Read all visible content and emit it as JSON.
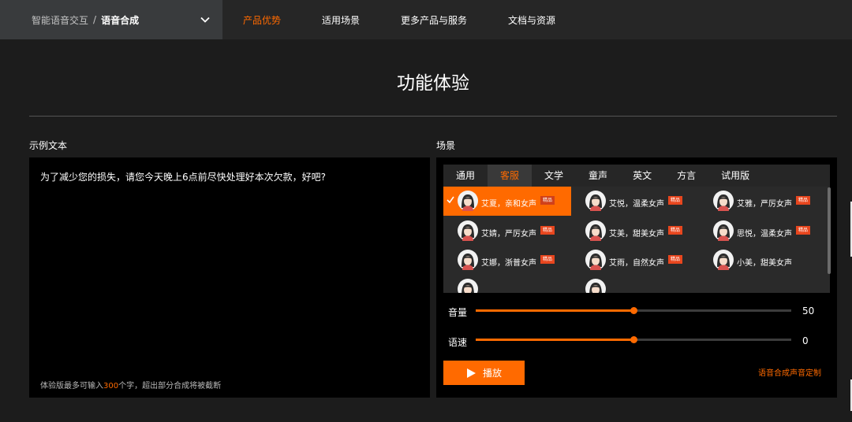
{
  "header": {
    "breadcrumb_parent": "智能语音交互",
    "breadcrumb_sep": "/",
    "breadcrumb_current": "语音合成",
    "nav": [
      {
        "label": "产品优势",
        "active": true
      },
      {
        "label": "适用场景",
        "active": false
      },
      {
        "label": "更多产品与服务",
        "active": false
      },
      {
        "label": "文档与资源",
        "active": false
      }
    ]
  },
  "page_title": "功能体验",
  "text_section": {
    "label": "示例文本",
    "sample_text": "为了减少您的损失，请您今天晚上6点前尽快处理好本次欠款，好吧?",
    "note_prefix": "体验版最多可输入",
    "note_count": "300",
    "note_suffix": "个字，超出部分合成将被截断"
  },
  "scene_section": {
    "label": "场景",
    "tabs": [
      "通用",
      "客服",
      "文学",
      "童声",
      "英文",
      "方言",
      "试用版"
    ],
    "active_tab": "客服",
    "badge_label": "精品",
    "voices": [
      {
        "name": "艾夏，亲和女声",
        "premium": true,
        "selected": true
      },
      {
        "name": "艾悦，温柔女声",
        "premium": true,
        "selected": false
      },
      {
        "name": "艾雅，严厉女声",
        "premium": true,
        "selected": false
      },
      {
        "name": "艾婧，严厉女声",
        "premium": true,
        "selected": false
      },
      {
        "name": "艾美，甜美女声",
        "premium": true,
        "selected": false
      },
      {
        "name": "思悦，温柔女声",
        "premium": true,
        "selected": false
      },
      {
        "name": "艾娜，浙普女声",
        "premium": true,
        "selected": false
      },
      {
        "name": "艾雨，自然女声",
        "premium": true,
        "selected": false
      },
      {
        "name": "小美，甜美女声",
        "premium": false,
        "selected": false
      }
    ],
    "volume": {
      "label": "音量",
      "value": "50",
      "level": 0.5
    },
    "speed": {
      "label": "语速",
      "value": "0",
      "level": 0.5
    },
    "play_label": "播放",
    "custom_link": "语音合成声音定制"
  },
  "colors": {
    "accent": "#ff6a00",
    "badge": "#e8461e"
  }
}
